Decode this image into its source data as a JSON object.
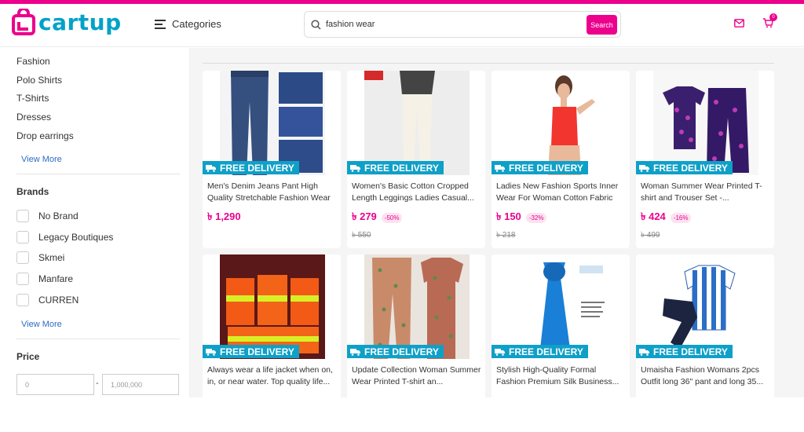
{
  "header": {
    "logo_text": "cartup",
    "categories_label": "Categories",
    "search_value": "fashion wear",
    "search_button": "Search",
    "cart_count": "0"
  },
  "sidebar": {
    "categories": [
      "Fashion",
      "Polo Shirts",
      "T-Shirts",
      "Dresses",
      "Drop earrings"
    ],
    "view_more_1": "View More",
    "brands_title": "Brands",
    "brands": [
      "No Brand",
      "Legacy Boutiques",
      "Skmei",
      "Manfare",
      "CURREN"
    ],
    "view_more_2": "View More",
    "price_title": "Price",
    "price_min_placeholder": "0",
    "price_separator": "-",
    "price_max_placeholder": "1,000,000"
  },
  "products": [
    {
      "title": "Men's Denim Jeans Pant High Quality Stretchable Fashion Wear",
      "price": "৳ 1,290",
      "discount": "",
      "old_price": "",
      "badge": "FREE DELIVERY"
    },
    {
      "title": "Women's Basic Cotton Cropped Length Leggings Ladies Casual...",
      "price": "৳ 279",
      "discount": "-50%",
      "old_price": "৳ 550",
      "badge": "FREE DELIVERY"
    },
    {
      "title": "Ladies New Fashion Sports Inner Wear For Woman Cotton Fabric",
      "price": "৳ 150",
      "discount": "-32%",
      "old_price": "৳ 218",
      "badge": "FREE DELIVERY"
    },
    {
      "title": "Woman Summer Wear Printed T-shirt and Trouser Set -...",
      "price": "৳ 424",
      "discount": "-16%",
      "old_price": "৳ 499",
      "badge": "FREE DELIVERY"
    },
    {
      "title": "Always wear a life jacket when on, in, or near water. Top quality life...",
      "price": "",
      "discount": "",
      "old_price": "",
      "badge": "FREE DELIVERY"
    },
    {
      "title": "Update Collection Woman Summer Wear Printed T-shirt an...",
      "price": "",
      "discount": "",
      "old_price": "",
      "badge": "FREE DELIVERY"
    },
    {
      "title": "Stylish High-Quality Formal Fashion Premium Silk Business...",
      "price": "",
      "discount": "",
      "old_price": "",
      "badge": "FREE DELIVERY"
    },
    {
      "title": "Umaisha Fashion Womans 2pcs Outfit long 36\" pant and long 35...",
      "price": "",
      "discount": "",
      "old_price": "",
      "badge": "FREE DELIVERY"
    }
  ],
  "colors": {
    "brand_pink": "#ec008c",
    "brand_blue": "#00a2c9",
    "badge_blue": "#0fa0c8"
  }
}
